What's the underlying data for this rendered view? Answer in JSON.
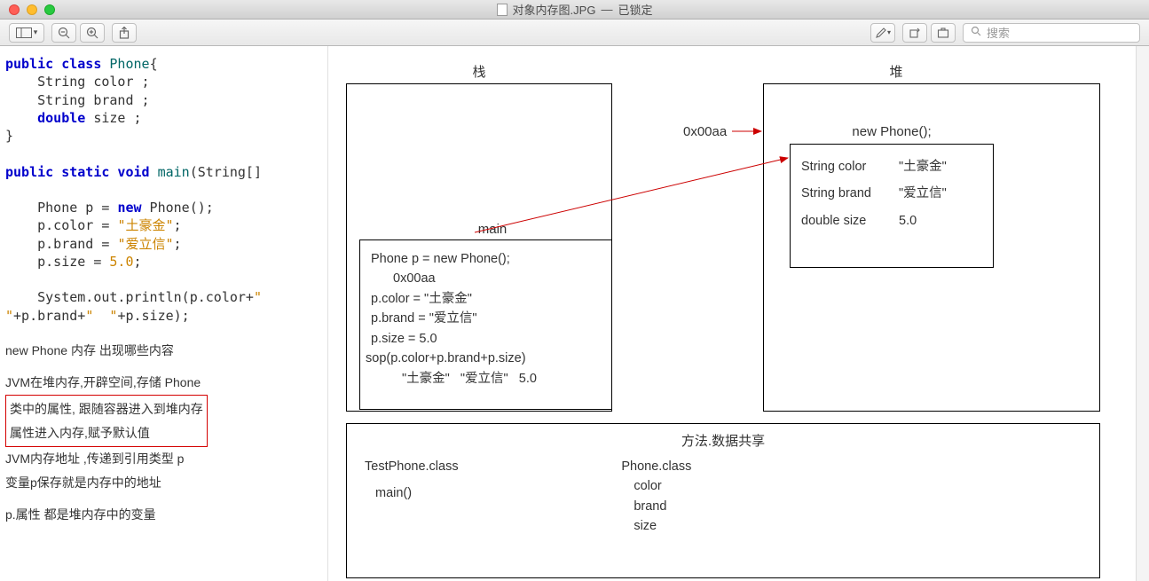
{
  "window": {
    "filename": "对象内存图.JPG",
    "status": "已锁定",
    "title_sep": " — "
  },
  "toolbar": {
    "search_placeholder": "搜索"
  },
  "code": {
    "line1_pre": "public class ",
    "line1_name": "Phone",
    "line1_post": "{",
    "line2": "    String color ;",
    "line3": "    String brand ;",
    "line4_pre": "    ",
    "line4_kw": "double",
    "line4_post": " size ;",
    "line5": "}",
    "line6_pre": "public static void ",
    "line6_name": "main",
    "line6_mid": "(String[]",
    "line7_a": "    Phone p = ",
    "line7_kw": "new",
    "line7_b": " Phone();",
    "line8_a": "    p.color = ",
    "line8_str": "\"土豪金\"",
    "line8_b": ";",
    "line9_a": "    p.brand = ",
    "line9_str": "\"爱立信\"",
    "line9_b": ";",
    "line10_a": "    p.size = ",
    "line10_num": "5.0",
    "line10_b": ";",
    "line11_a": "    System.out.println(p.color+",
    "line11_str1": "\"",
    "line12_str": "\"",
    "line12_a": "+p.brand+",
    "line12_str2": "\"  \"",
    "line12_b": "+p.size);"
  },
  "notes": {
    "n1": "new Phone 内存 出现哪些内容",
    "n2": "JVM在堆内存,开辟空间,存储 Phone",
    "boxed1": "类中的属性, 跟随容器进入到堆内存",
    "boxed2": "属性进入内存,赋予默认值",
    "n3": "JVM内存地址 ,传递到引用类型 p",
    "n4": "变量p保存就是内存中的地址",
    "n5": "p.属性  都是堆内存中的变量"
  },
  "diagram": {
    "stack_label": "栈",
    "heap_label": "堆",
    "addr": "0x00aa",
    "main_label": "main",
    "main_lines": {
      "l1": "Phone p = new Phone();",
      "l2": "0x00aa",
      "l3": "p.color = \"土豪金\"",
      "l4": "p.brand = \"爱立信\"",
      "l5": "p.size = 5.0",
      "l6": "sop(p.color+p.brand+p.size)",
      "l7a": "\"土豪金\"",
      "l7b": "\"爱立信\"",
      "l7c": "5.0"
    },
    "heap_title": "new Phone();",
    "heap_rows": [
      {
        "name": "String color",
        "value": "\"土豪金\""
      },
      {
        "name": "String brand",
        "value": "\"爱立信\""
      },
      {
        "name": "double size",
        "value": "5.0"
      }
    ],
    "share": {
      "title": "方法.数据共享",
      "col1_a": "TestPhone.class",
      "col1_b": "main()",
      "col2_a": "Phone.class",
      "col2_b": "color",
      "col2_c": "brand",
      "col2_d": "size"
    }
  }
}
